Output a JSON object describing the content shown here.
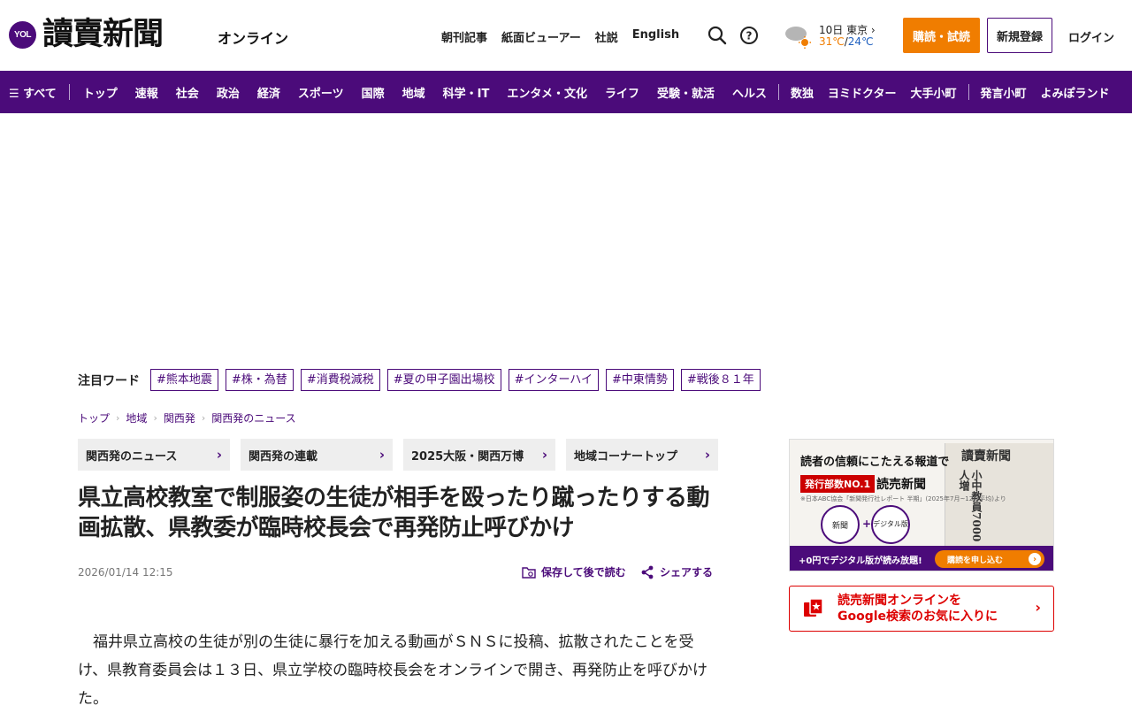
{
  "header": {
    "logo_badge": "YOL",
    "logo_name": "讀賣新聞",
    "logo_sub": "オンライン",
    "links": [
      "朝刊記事",
      "紙面ビューアー",
      "社説",
      "English"
    ],
    "weather": {
      "date_city": "10日 東京",
      "high": "31℃",
      "sep": "/",
      "low": "24℃"
    },
    "subscribe_label": "購読・試読",
    "register_label": "新規登録",
    "login_label": "ログイン"
  },
  "nav": {
    "menu_label": "☰ すべて",
    "items_a": [
      "トップ",
      "速報",
      "社会",
      "政治",
      "経済",
      "スポーツ",
      "国際",
      "地域",
      "科学・IT",
      "エンタメ・文化",
      "ライフ",
      "受験・就活",
      "ヘルス"
    ],
    "items_b": [
      "数独",
      "ヨミドクター",
      "大手小町"
    ],
    "items_c": [
      "発言小町",
      "よみぽランド"
    ]
  },
  "trending": {
    "label": "注目ワード",
    "tags": [
      "#熊本地震",
      "#株・為替",
      "#消費税減税",
      "#夏の甲子園出場校",
      "#インターハイ",
      "#中東情勢",
      "#戦後８１年"
    ]
  },
  "breadcrumb": [
    "トップ",
    "地域",
    "関西発",
    "関西発のニュース"
  ],
  "subnav": [
    "関西発のニュース",
    "関西発の連載",
    "2025大阪・関西万博",
    "地域コーナートップ"
  ],
  "article": {
    "title": "県立高校教室で制服姿の生徒が相手を殴ったり蹴ったりする動画拡散、県教委が臨時校長会で再発防止呼びかけ",
    "date": "2026/01/14 12:15",
    "save_label": "保存して後で読む",
    "share_label": "シェアする",
    "body": "福井県立高校の生徒が別の生徒に暴行を加える動画がＳＮＳに投稿、拡散されたことを受け、県教育委員会は１３日、県立学校の臨時校長会をオンラインで開き、再発防止を呼びかけた。"
  },
  "banner": {
    "headline": "読者の信頼にこたえる報道で",
    "badge": "発行部数NO.1",
    "name": "読売新聞",
    "note": "※日本ABC協会「新聞発行社レポート 半期」(2025年7月~12月平均)より",
    "circle1": "新聞",
    "plus": "+",
    "circle2": "デジタル版",
    "paper_logo": "讀賣新聞",
    "paper_text": "小中教員7000人増",
    "bar_text": "+0円でデジタル版が読み放題!",
    "cta": "購読を申し込む"
  },
  "google_box": {
    "line1": "読売新聞オンラインを",
    "line2": "Google検索のお気に入りに"
  },
  "colors": {
    "brand": "#4b0b7a",
    "accent": "#f07d00",
    "temp_high": "#f07d00",
    "temp_low": "#1e5fbf"
  }
}
